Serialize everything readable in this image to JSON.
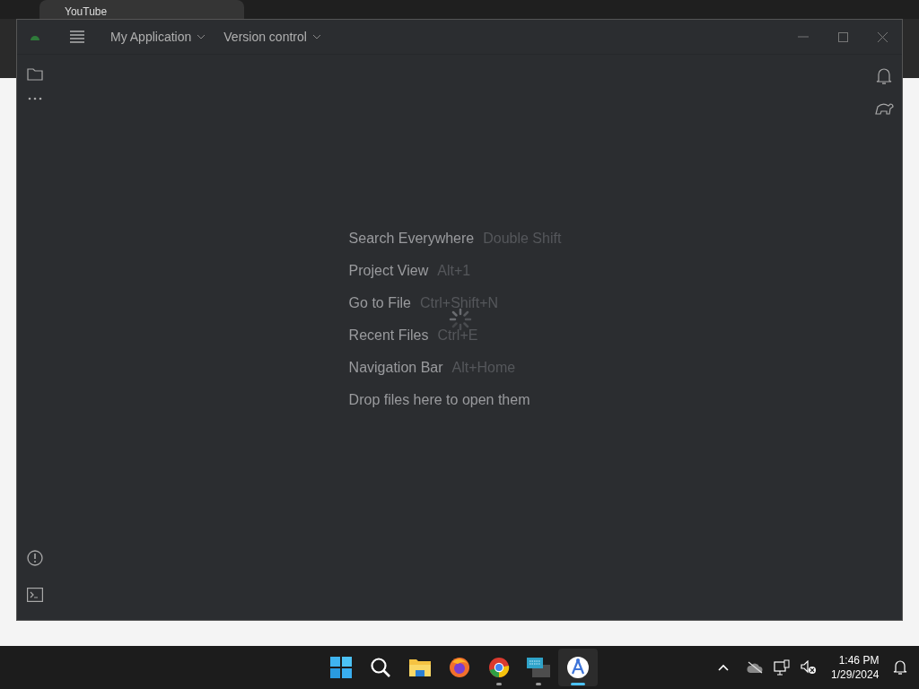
{
  "browser_tab": {
    "title": "YouTube"
  },
  "ide": {
    "project": "My Application",
    "vcs": "Version control",
    "hints": [
      {
        "kind": "shortcut",
        "action": "Search Everywhere",
        "shortcut": "Double Shift"
      },
      {
        "kind": "shortcut",
        "action": "Project View",
        "shortcut": "Alt+1"
      },
      {
        "kind": "shortcut",
        "action": "Go to File",
        "shortcut": "Ctrl+Shift+N"
      },
      {
        "kind": "shortcut",
        "action": "Recent Files",
        "shortcut": "Ctrl+E"
      },
      {
        "kind": "shortcut",
        "action": "Navigation Bar",
        "shortcut": "Alt+Home"
      },
      {
        "kind": "plain",
        "action": "Drop files here to open them"
      }
    ]
  },
  "taskbar": {
    "apps": [
      {
        "kind": "start",
        "running": false,
        "selected": false
      },
      {
        "kind": "search",
        "running": false,
        "selected": false
      },
      {
        "kind": "files",
        "running": false,
        "selected": false
      },
      {
        "kind": "firefox",
        "running": false,
        "selected": false
      },
      {
        "kind": "chrome",
        "running": true,
        "selected": false
      },
      {
        "kind": "terminal",
        "running": true,
        "selected": false
      },
      {
        "kind": "studio",
        "running": true,
        "selected": true
      }
    ],
    "time": "1:46 PM",
    "date": "1/29/2024"
  }
}
